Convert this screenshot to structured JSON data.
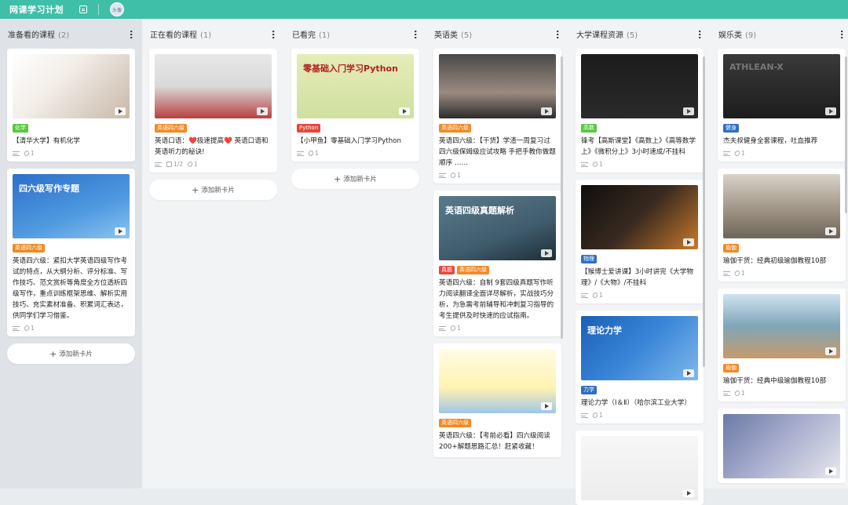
{
  "app": {
    "title": "网课学习计划",
    "avatar_text": "头像"
  },
  "columns": [
    {
      "name": "准备看的课程",
      "count": "(2)",
      "add_label": "添加新卡片",
      "cards": [
        {
          "thumb": "linear-gradient(135deg,#ffffff 0%,#f2ede8 40%,#c8b8a8 100%)",
          "tags": [
            {
              "text": "化学",
              "color": "#57c83f"
            }
          ],
          "title": "【清华大学】有机化学",
          "attachments": "1"
        },
        {
          "thumb": "linear-gradient(160deg,#2d6ec8 0%,#4f9ae0 60%,#8cc3f0 100%)",
          "overlay": "四六级写作专题",
          "tags": [
            {
              "text": "英语四六级",
              "color": "#f08a24"
            }
          ],
          "title": "英语四六级：紧扣大学英语四级写作考试的特点，从大纲分析、评分标准、写作技巧、范文赏析等角度全方位透析四级写作，重点训练框架思维、解析实用技巧、充实素材准备、积累词汇表达，供同学们学习借鉴。",
          "attachments": "1"
        }
      ]
    },
    {
      "name": "正在看的课程",
      "count": "(1)",
      "add_label": "添加新卡片",
      "cards": [
        {
          "thumb": "linear-gradient(180deg,#e8e8e8 0%,#d9d9d9 50%,#b94040 100%)",
          "tags": [
            {
              "text": "英语四六级",
              "color": "#f08a24"
            }
          ],
          "title": "英语口语：❤️极速提高❤️ 英语口语和英语听力的秘诀!",
          "checklist": "1/2",
          "attachments": "1"
        }
      ]
    },
    {
      "name": "已看完",
      "count": "(1)",
      "add_label": "添加新卡片",
      "cards": [
        {
          "thumb": "linear-gradient(180deg,#e6ecb8 0%,#cfe0a0 100%)",
          "overlay": "零基础入门学习Python",
          "overlay_color": "#b02020",
          "tags": [
            {
              "text": "Python",
              "color": "#e8453c"
            }
          ],
          "title": "【小甲鱼】零基础入门学习Python",
          "attachments": "1"
        }
      ]
    },
    {
      "name": "英语类",
      "count": "(5)",
      "cards": [
        {
          "thumb": "linear-gradient(180deg,#4a4a4a 0%,#9a8a80 60%,#2c2c2c 100%)",
          "tags": [
            {
              "text": "英语四六级",
              "color": "#f08a24"
            }
          ],
          "title": "英语四六级：【干货】学渣一周复习过四六级保姆级应试攻略 手把手教你做题顺序 ……",
          "attachments": "1"
        },
        {
          "thumb": "linear-gradient(160deg,#5a7a8a 0%,#3f5c6c 60%,#1e2e38 100%)",
          "overlay": "英语四级真题解析",
          "tags": [
            {
              "text": "真题",
              "color": "#e8453c"
            },
            {
              "text": "英语四六级",
              "color": "#f08a24"
            }
          ],
          "title": "英语四六级：自制 9套四级真题写作听力阅读翻译全面详尽解析，实战技巧分析，为急需考前辅导和冲刺复习指导的考生提供及时快速的应试指南。",
          "attachments": "1"
        },
        {
          "thumb": "linear-gradient(180deg,#fffbe6 0%,#fff3b0 60%,#9fc6e8 100%)",
          "tags": [
            {
              "text": "英语四六级",
              "color": "#f08a24"
            }
          ],
          "title": "英语四六级：【考前必看】四六级阅读200+解题思路汇总！赶紧收藏！"
        }
      ]
    },
    {
      "name": "大学课程资源",
      "count": "(5)",
      "cards": [
        {
          "thumb": "linear-gradient(180deg,#1c1c1c 0%,#2a2a2a 100%)",
          "tags": [
            {
              "text": "高数",
              "color": "#57c83f"
            }
          ],
          "title": "锋考【高斯课堂】《高数上》《高等数学上》《微积分上》3小时速成/不挂科",
          "attachments": "1"
        },
        {
          "thumb": "linear-gradient(135deg,#0e0e0e 0%,#3a2a20 50%,#c97a2a 100%)",
          "tags": [
            {
              "text": "物理",
              "color": "#2f6fc0"
            }
          ],
          "title": "【猴博士爱讲课】3小时讲完《大学物理》/《大物》/不挂科",
          "attachments": "1"
        },
        {
          "thumb": "linear-gradient(135deg,#1a5fb8 0%,#3a86d8 50%,#7fb8ec 100%)",
          "overlay": "理论力学",
          "tags": [
            {
              "text": "力学",
              "color": "#2f6fc0"
            }
          ],
          "title": "理论力学（Ⅰ＆Ⅱ）（哈尔滨工业大学）",
          "attachments": "1"
        },
        {
          "thumb": "linear-gradient(180deg,#f7f7f7 0%,#ececec 100%)"
        }
      ]
    },
    {
      "name": "娱乐类",
      "count": "(9)",
      "cards": [
        {
          "thumb": "linear-gradient(180deg,#3a3a3a 0%,#1c1c1c 100%)",
          "overlay": "ATHLEAN-X",
          "overlay_color": "#777",
          "tags": [
            {
              "text": "健身",
              "color": "#2f6fc0"
            }
          ],
          "title": "杰夫叔健身全套课程，吐血推荐",
          "attachments": "1"
        },
        {
          "thumb": "linear-gradient(180deg,#d9d3c8 0%,#9a8f80 60%,#6d6458 100%)",
          "tags": [
            {
              "text": "瑜伽",
              "color": "#f08a24"
            }
          ],
          "title": "瑜伽干货：经典初级瑜伽教程10部",
          "attachments": "1"
        },
        {
          "thumb": "linear-gradient(180deg,#cfe3f2 0%,#7fa6b8 50%,#c79a6a 100%)",
          "tags": [
            {
              "text": "瑜伽",
              "color": "#f08a24"
            }
          ],
          "title": "瑜伽干货：经典中级瑜伽教程10部",
          "attachments": "1"
        },
        {
          "thumb": "linear-gradient(135deg,#6c7aa8 0%,#aab0cf 50%,#e8e8ee 100%)"
        }
      ]
    }
  ]
}
